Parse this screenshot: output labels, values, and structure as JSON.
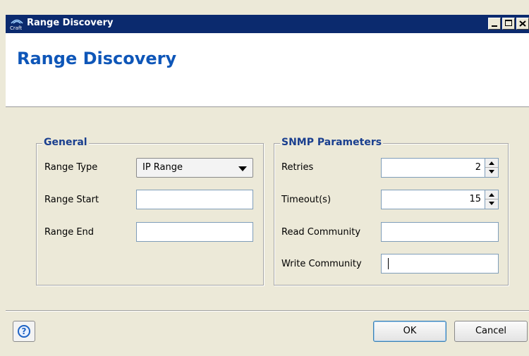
{
  "window": {
    "title": "Range Discovery",
    "logo_text": "Craft",
    "buttons": [
      "minimize",
      "maximize",
      "close"
    ]
  },
  "banner": {
    "title": "Range Discovery"
  },
  "general": {
    "title": "General",
    "range_type_label": "Range Type",
    "range_type_value": "IP Range",
    "range_start_label": "Range Start",
    "range_start_value": "",
    "range_end_label": "Range End",
    "range_end_value": ""
  },
  "snmp": {
    "title": "SNMP Parameters",
    "retries_label": "Retries",
    "retries_value": "2",
    "timeout_label": "Timeout(s)",
    "timeout_value": "15",
    "read_community_label": "Read Community",
    "read_community_value": "",
    "write_community_label": "Write Community",
    "write_community_value": ""
  },
  "footer": {
    "help_symbol": "?",
    "ok_label": "OK",
    "cancel_label": "Cancel"
  },
  "colors": {
    "titlebar": "#0b2a6e",
    "banner_title": "#0e56b8",
    "group_title": "#1a3f8f",
    "dialog_bg": "#ece9d8"
  }
}
